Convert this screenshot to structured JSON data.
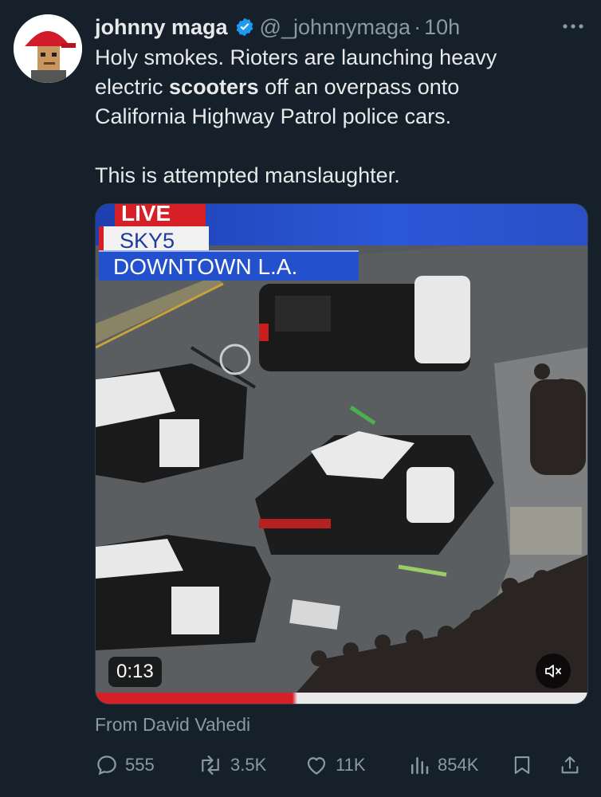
{
  "author": {
    "name": "johnny maga",
    "handle": "@_johnnymaga",
    "separator": "·",
    "time": "10h"
  },
  "tweet": {
    "line1": "Holy smokes. Rioters are launching heavy",
    "line2_pre": "electric ",
    "line2_bold": "scooters",
    "line2_post": " off an overpass onto",
    "line3": "California Highway Patrol police cars.",
    "line4": "This is attempted manslaughter."
  },
  "media": {
    "live_label": "LIVE",
    "station_label": "SKY5",
    "location_label": "DOWNTOWN L.A.",
    "duration": "0:13",
    "mute_icon": "muted-speaker-icon"
  },
  "attribution": "From David Vahedi",
  "actions": {
    "replies": "555",
    "retweets": "3.5K",
    "likes": "11K",
    "views": "854K"
  },
  "colors": {
    "background": "#15202b",
    "text_primary": "#e7e9ea",
    "text_secondary": "#8b98a5",
    "verified": "#1d9bf0",
    "news_red": "#d61f26",
    "news_blue": "#2350cc"
  },
  "icons": [
    "verified-badge-icon",
    "more-options-icon",
    "reply-icon",
    "retweet-icon",
    "like-icon",
    "views-icon",
    "bookmark-icon",
    "share-icon"
  ]
}
